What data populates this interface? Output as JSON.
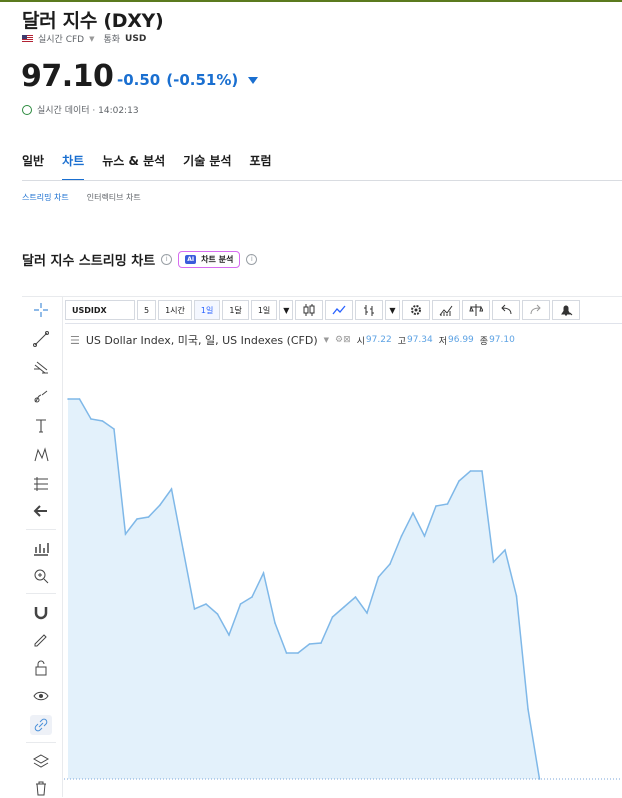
{
  "header": {
    "title": "달러 지수 (DXY)",
    "source": "실시간 CFD",
    "currency_label": "통화",
    "currency": "USD"
  },
  "quote": {
    "price": "97.10",
    "change": "-0.50",
    "change_pct": "(-0.51%)",
    "status": "실시간 데이터 · 14:02:13"
  },
  "nav": {
    "tabs": [
      "일반",
      "차트",
      "뉴스 & 분석",
      "기술 분석",
      "포럼"
    ],
    "active": "차트",
    "subtabs": [
      "스트리밍 차트",
      "인터렉티브 차트"
    ]
  },
  "section": {
    "title": "달러 지수 스트리밍 차트",
    "ai_badge": "AI",
    "ai_label": "차트 분석"
  },
  "toolbar": {
    "symbol": "USDIDX",
    "intervals": [
      "5",
      "1시간",
      "1일",
      "1달",
      "1일"
    ],
    "selected_interval": "1일"
  },
  "legend": {
    "name": "US Dollar Index, 미국, 일, US Indexes (CFD)",
    "open_label": "시",
    "open": "97.22",
    "high_label": "고",
    "high": "97.34",
    "low_label": "저",
    "low": "96.99",
    "close_label": "종",
    "close": "97.10"
  },
  "colors": {
    "accent": "#1a6fd0",
    "line": "#7fb8e8",
    "fill": "#e3f1fb"
  },
  "icons": [
    "crosshair-icon",
    "trendline-icon",
    "fib-icon",
    "brush-icon",
    "text-icon",
    "pattern-icon",
    "measure-icon",
    "back-arrow-icon",
    "chart-icon",
    "zoom-icon",
    "magnet-icon",
    "lock-pencil-icon",
    "unlock-icon",
    "eye-icon",
    "link-icon",
    "layers-icon",
    "trash-icon"
  ],
  "chart_data": {
    "type": "area",
    "title": "",
    "series": [
      {
        "values": [
          98.9,
          98.9,
          98.7,
          98.68,
          98.6,
          97.55,
          97.7,
          97.72,
          97.84,
          98.0,
          97.4,
          96.8,
          96.85,
          96.75,
          96.54,
          96.85,
          96.92,
          97.16,
          96.66,
          96.36,
          96.36,
          96.45,
          96.46,
          96.72,
          96.82,
          96.92,
          96.76,
          97.12,
          97.25,
          97.53,
          97.76,
          97.53,
          97.83,
          97.85,
          98.08,
          98.18,
          98.18,
          97.27,
          97.39,
          96.93,
          95.8,
          95.1
        ]
      }
    ],
    "ylim": [
      95.1,
      99.65
    ],
    "grid": false
  }
}
